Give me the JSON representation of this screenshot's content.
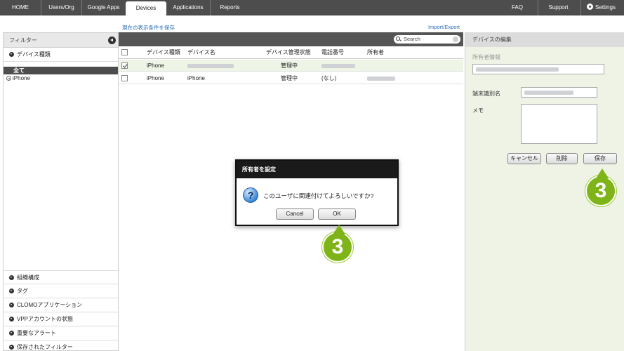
{
  "nav": {
    "tabs": [
      {
        "label": "HOME"
      },
      {
        "label": "Users/Org"
      },
      {
        "label": "Google Apps"
      },
      {
        "label": "Devices",
        "active": true
      },
      {
        "label": "Applications"
      },
      {
        "label": "Reports"
      }
    ],
    "right": [
      {
        "label": "FAQ"
      },
      {
        "label": "Support"
      },
      {
        "label": "Settings",
        "icon": "gear-icon"
      }
    ]
  },
  "links": {
    "save_view": "現在の表示条件を保存",
    "import_export": "Import/Export"
  },
  "sidebar": {
    "header": "フィルター",
    "device_type_section": "デバイス種類",
    "selected_item": "全て",
    "items": [
      {
        "label": "iPhone"
      }
    ],
    "bottom_sections": [
      {
        "label": "組織構成"
      },
      {
        "label": "タグ"
      },
      {
        "label": "CLOMOアプリケーション"
      },
      {
        "label": "VPPアカウントの状態"
      },
      {
        "label": "重要なアラート"
      },
      {
        "label": "保存されたフィルター"
      }
    ]
  },
  "table": {
    "search_placeholder": "Search",
    "columns": [
      "デバイス種類",
      "デバイス名",
      "デバイス管理状態",
      "電話番号",
      "所有者"
    ],
    "rows": [
      {
        "checked": true,
        "type": "iPhone",
        "name": "",
        "status": "管理中",
        "phone": "",
        "owner": ""
      },
      {
        "checked": false,
        "type": "iPhone",
        "name": "iPhone",
        "status": "管理中",
        "phone": "(なし)",
        "owner": ""
      }
    ]
  },
  "edit_panel": {
    "title": "デバイスの編集",
    "owner_label": "所有者情報",
    "device_name_label": "端末識別名",
    "memo_label": "メモ",
    "cancel_button": "キャンセル",
    "delete_button": "削除",
    "save_button": "保存"
  },
  "dialog": {
    "title": "所有者を設定",
    "message": "このユーザに関連付けてよろしいですか?",
    "cancel_button": "Cancel",
    "ok_button": "OK"
  },
  "badges": {
    "step": "3"
  },
  "colors": {
    "nav_bg": "#4d4d4d",
    "badge_green": "#7fb418",
    "panel_bg": "#eef3e6",
    "row_highlight": "#eef4e6"
  }
}
